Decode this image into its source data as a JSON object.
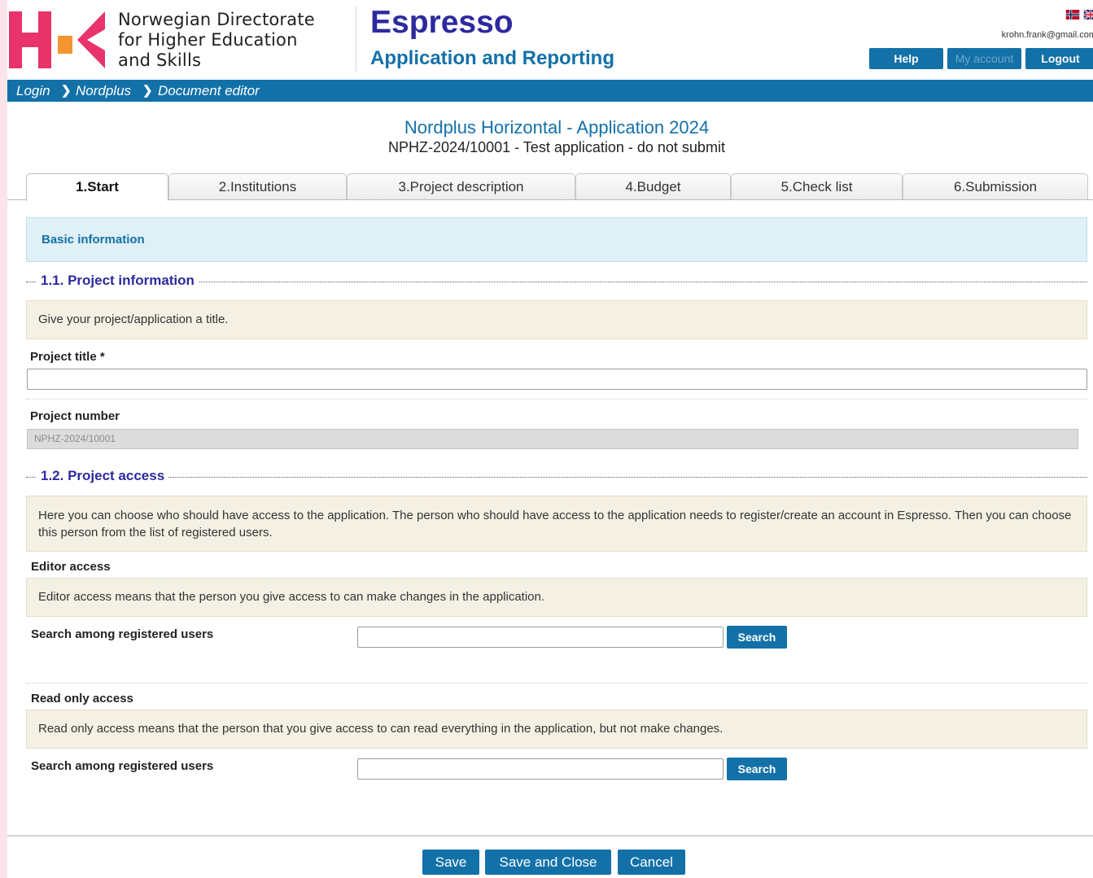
{
  "header": {
    "org_name_lines": [
      "Norwegian Directorate",
      "for Higher Education",
      "and Skills"
    ],
    "app_title": "Espresso",
    "app_subtitle": "Application and Reporting",
    "user_email": "krohn.frank@gmail.com",
    "buttons": {
      "help": "Help",
      "my_account": "My account",
      "logout": "Logout"
    }
  },
  "breadcrumb": [
    "Login",
    "Nordplus",
    "Document editor"
  ],
  "document": {
    "title": "Nordplus Horizontal - Application 2024",
    "subtitle": "NPHZ-2024/10001 - Test application - do not submit"
  },
  "tabs": [
    "1.Start",
    "2.Institutions",
    "3.Project description",
    "4.Budget",
    "5.Check list",
    "6.Submission"
  ],
  "active_tab": "1.Start",
  "basic_info": "Basic information",
  "project_information": {
    "heading": "1.1. Project information",
    "instruction": "Give your project/application a title.",
    "title_label": "Project title",
    "required_mark": "*",
    "title_value": "",
    "number_label": "Project number",
    "number_value": "NPHZ-2024/10001"
  },
  "project_access": {
    "heading": "1.2. Project access",
    "intro": "Here you can choose who should have access to the application. The person who should have access to the application needs to register/create an account in Espresso. Then you can choose this person from the list of registered users.",
    "editor": {
      "label": "Editor access",
      "desc": "Editor access means that the person you give access to can make changes in the application.",
      "search_label": "Search among registered users",
      "search_value": "",
      "search_button": "Search"
    },
    "readonly": {
      "label": "Read only access",
      "desc": "Read only access means that the person that you give access to can read everything in the application, but not make changes.",
      "search_label": "Search among registered users",
      "search_value": "",
      "search_button": "Search"
    }
  },
  "footer": {
    "save": "Save",
    "save_close": "Save and Close",
    "cancel": "Cancel"
  },
  "colors": {
    "primary": "#1371a8",
    "title_navy": "#2d2a9e",
    "logo_pink": "#e8336b",
    "logo_orange": "#f39530",
    "info_bg": "#f4f1e4",
    "section_bg": "#dff0f7"
  }
}
